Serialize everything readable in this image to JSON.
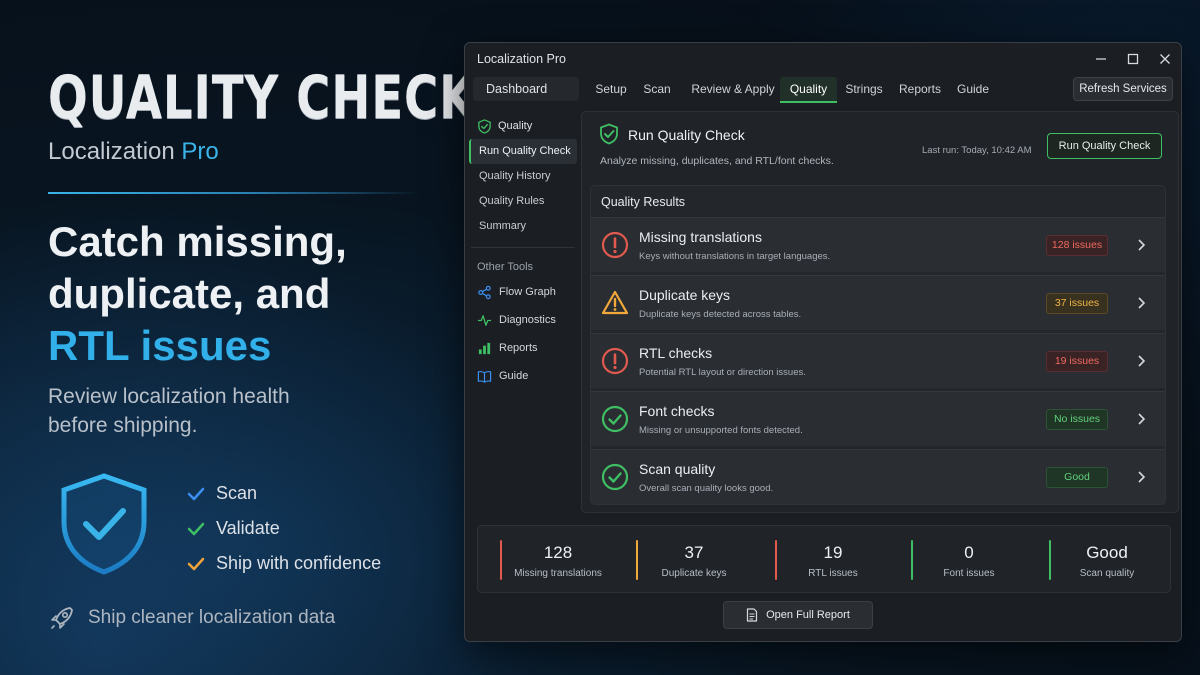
{
  "promo": {
    "title": "QUALITY CHECK",
    "subtitle_main": "Localization",
    "subtitle_accent": "Pro",
    "headline_line1": "Catch missing,",
    "headline_line2": "duplicate, and",
    "headline_accent": "RTL issues",
    "description_line1": "Review localization health",
    "description_line2": "before shipping.",
    "checks": [
      {
        "label": "Scan",
        "color": "#3b8ff0"
      },
      {
        "label": "Validate",
        "color": "#3fbf64"
      },
      {
        "label": "Ship with confidence",
        "color": "#f2a33a"
      }
    ],
    "footer": "Ship cleaner localization data",
    "icons": {
      "shield": "shield-check-icon",
      "footer": "rocket-icon"
    }
  },
  "window": {
    "title": "Localization Pro",
    "controls": [
      "minimize-icon",
      "maximize-icon",
      "close-icon"
    ]
  },
  "tabs": {
    "dashboard": "Dashboard",
    "items": [
      "Setup",
      "Scan",
      "Review & Apply",
      "Quality",
      "Strings",
      "Reports",
      "Guide"
    ],
    "active": "Quality",
    "refresh": "Refresh Services"
  },
  "sidebar": {
    "section": "Quality",
    "items": [
      "Run Quality Check",
      "Quality History",
      "Quality Rules",
      "Summary"
    ],
    "active": "Run Quality Check",
    "other_label": "Other Tools",
    "tools": [
      {
        "label": "Flow Graph",
        "icon": "flow-graph-icon"
      },
      {
        "label": "Diagnostics",
        "icon": "pulse-icon"
      },
      {
        "label": "Reports",
        "icon": "bar-chart-icon"
      },
      {
        "label": "Guide",
        "icon": "book-icon"
      }
    ]
  },
  "run": {
    "title": "Run Quality Check",
    "description": "Analyze missing, duplicates, and RTL/font checks.",
    "last_run": "Last run: Today, 10:42 AM",
    "button": "Run Quality Check"
  },
  "results": {
    "title": "Quality Results",
    "rows": [
      {
        "title": "Missing translations",
        "sub": "Keys without translations in target languages.",
        "badge": "128 issues",
        "status": "error",
        "icon": "alert-circle-icon"
      },
      {
        "title": "Duplicate keys",
        "sub": "Duplicate keys detected across tables.",
        "badge": "37 issues",
        "status": "warning",
        "icon": "warning-triangle-icon"
      },
      {
        "title": "RTL checks",
        "sub": "Potential RTL layout or direction issues.",
        "badge": "19 issues",
        "status": "error",
        "icon": "alert-circle-icon"
      },
      {
        "title": "Font checks",
        "sub": "Missing or unsupported fonts detected.",
        "badge": "No issues",
        "status": "ok",
        "icon": "check-circle-icon"
      },
      {
        "title": "Scan quality",
        "sub": "Overall scan quality looks good.",
        "badge": "Good",
        "status": "ok",
        "icon": "check-circle-icon"
      }
    ]
  },
  "stats": [
    {
      "value": "128",
      "label": "Missing translations",
      "color": "#e05a4f"
    },
    {
      "value": "37",
      "label": "Duplicate keys",
      "color": "#f0a93a"
    },
    {
      "value": "19",
      "label": "RTL issues",
      "color": "#e05a4f"
    },
    {
      "value": "0",
      "label": "Font issues",
      "color": "#3fbf64"
    },
    {
      "value": "Good",
      "label": "Scan quality",
      "color": "#3fbf64"
    }
  ],
  "report_button": "Open Full Report",
  "colors": {
    "accent": "#3ab4e8",
    "ok": "#3fbf64",
    "error": "#e05a4f",
    "warning": "#f0a93a"
  }
}
